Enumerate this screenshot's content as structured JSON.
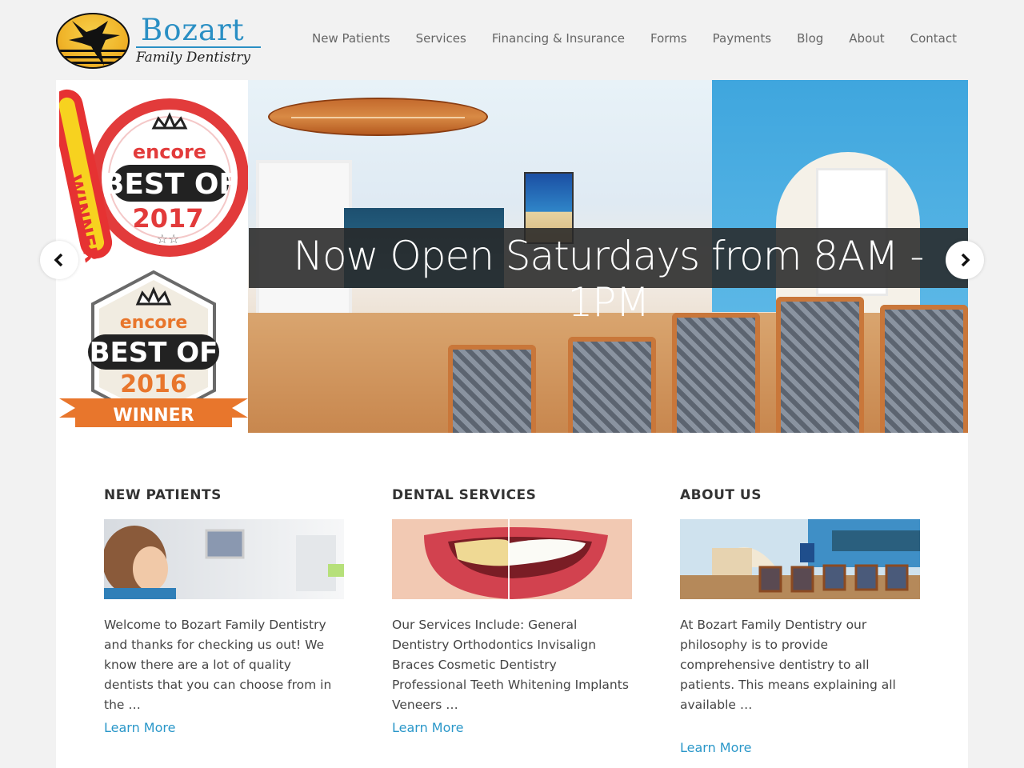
{
  "brand": {
    "name": "Bozart",
    "tagline": "Family Dentistry",
    "colors": {
      "accent": "#2a8fc4",
      "link": "#2a97c9",
      "logo_gold": "#f0b52a"
    }
  },
  "nav": {
    "items": [
      {
        "label": "New Patients"
      },
      {
        "label": "Services"
      },
      {
        "label": "Financing & Insurance"
      },
      {
        "label": "Forms"
      },
      {
        "label": "Payments"
      },
      {
        "label": "Blog"
      },
      {
        "label": "About"
      },
      {
        "label": "Contact"
      }
    ]
  },
  "slider": {
    "caption": "Now Open Saturdays from 8AM - 1PM",
    "prev_icon": "chevron-left-icon",
    "next_icon": "chevron-right-icon",
    "awards": [
      {
        "banner": "WINNER",
        "brand": "encore",
        "title": "BEST OF",
        "year": "2017"
      },
      {
        "brand": "encore",
        "title": "BEST OF",
        "year": "2016",
        "banner": "WINNER"
      }
    ]
  },
  "sections": [
    {
      "heading": "NEW PATIENTS",
      "text": "Welcome to Bozart Family Dentistry and thanks for checking us out! We know there are a lot of quality dentists that you can choose from in the …",
      "link": "Learn More"
    },
    {
      "heading": "DENTAL SERVICES",
      "text": "Our Services Include: General Dentistry Orthodontics Invisalign Braces Cosmetic Dentistry Professional Teeth Whitening Implants Veneers …",
      "link": "Learn More"
    },
    {
      "heading": "ABOUT US",
      "text": "At Bozart Family Dentistry our philosophy is to provide comprehensive dentistry to all patients.  This means explaining all available …",
      "link": "Learn More"
    }
  ]
}
